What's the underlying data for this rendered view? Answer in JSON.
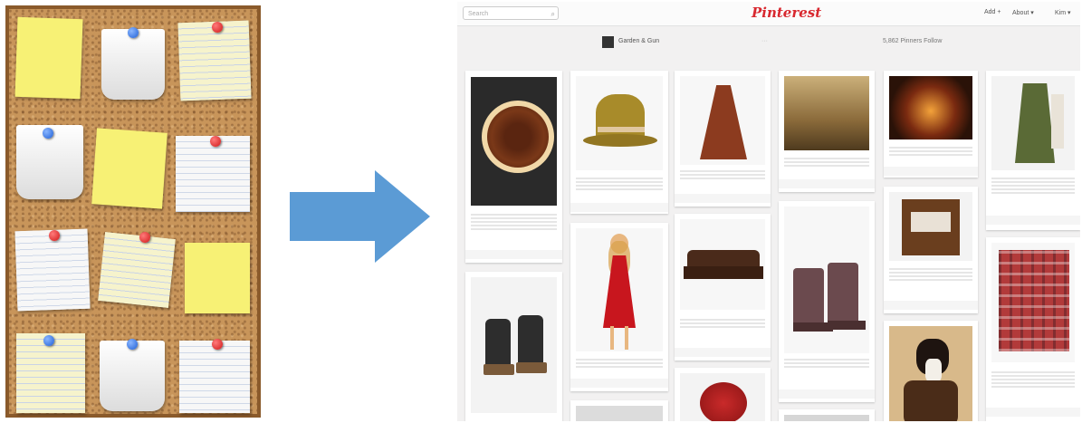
{
  "corkboard": {
    "notes": [
      {
        "kind": "yellow",
        "pin": ""
      },
      {
        "kind": "pocket",
        "pin": "blue"
      },
      {
        "kind": "ruled",
        "pin": "red"
      },
      {
        "kind": "pocket",
        "pin": "blue"
      },
      {
        "kind": "yellow",
        "pin": ""
      },
      {
        "kind": "white",
        "pin": "red"
      },
      {
        "kind": "white",
        "pin": "red"
      },
      {
        "kind": "ruled",
        "pin": "red"
      },
      {
        "kind": "yellow",
        "pin": ""
      },
      {
        "kind": "ruled",
        "pin": "blue"
      },
      {
        "kind": "pocket",
        "pin": "blue"
      },
      {
        "kind": "white",
        "pin": "red"
      }
    ],
    "colors": {
      "cork": "#c8955a",
      "frame": "#8a5a2b",
      "yellow": "#f7f175",
      "pin_red": "#d01818",
      "pin_blue": "#1e5fd6"
    }
  },
  "arrow": {
    "color": "#5b9bd5",
    "direction": "right"
  },
  "pinterest": {
    "logo": "Pinterest",
    "search_placeholder": "Search",
    "nav": [
      "Add +",
      "About ▾",
      "Kim ▾"
    ],
    "profile_name": "Garden & Gun",
    "stats_mid": "···",
    "stats": "5,862 Pinners Follow",
    "brand_color": "#d8282f",
    "pins": [
      {
        "subject": "pecan pie"
      },
      {
        "subject": "rain boots"
      },
      {
        "subject": "hat"
      },
      {
        "subject": "red dress"
      },
      {
        "subject": "boots"
      },
      {
        "subject": "cape"
      },
      {
        "subject": "sofa"
      },
      {
        "subject": "flowers"
      },
      {
        "subject": "landscape"
      },
      {
        "subject": "ankle boots"
      },
      {
        "subject": "fireplace"
      },
      {
        "subject": "frame"
      },
      {
        "subject": "dog"
      },
      {
        "subject": "vest"
      },
      {
        "subject": "plaid shirt"
      }
    ]
  }
}
